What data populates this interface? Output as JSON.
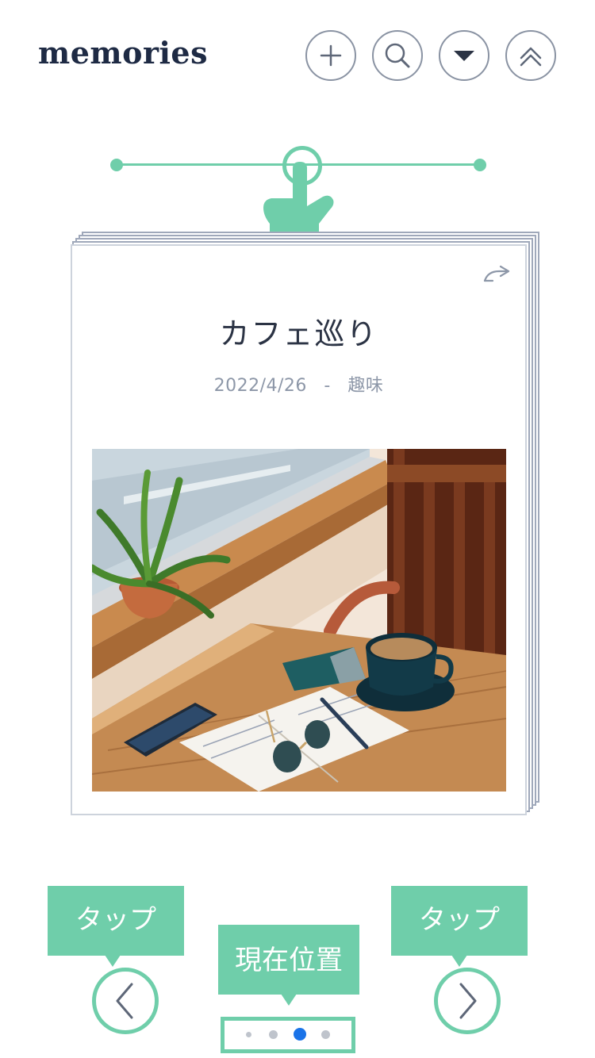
{
  "header": {
    "logo": "memories",
    "buttons": [
      "add",
      "search",
      "dropdown",
      "scroll-top"
    ]
  },
  "icons": {
    "add": "plus-icon",
    "search": "search-icon",
    "dropdown": "triangle-down-icon",
    "scroll_top": "double-chevron-up-icon",
    "hand": "pointing-hand-icon",
    "return": "return-arrow-icon",
    "prev": "chevron-left-icon",
    "next": "chevron-right-icon"
  },
  "card": {
    "title": "カフェ巡り",
    "date": "2022/4/26",
    "separator": "-",
    "category": "趣味"
  },
  "annotations": {
    "tap_left": "タップ",
    "tap_right": "タップ",
    "current_position": "現在位置"
  },
  "pagination": {
    "total": 4,
    "current_index": 3
  },
  "colors": {
    "accent": "#6fceaa",
    "active_dot": "#1a73e8",
    "inactive_dot": "#bfc4cc",
    "text_dark": "#2b3344",
    "text_muted": "#8d97a8"
  }
}
